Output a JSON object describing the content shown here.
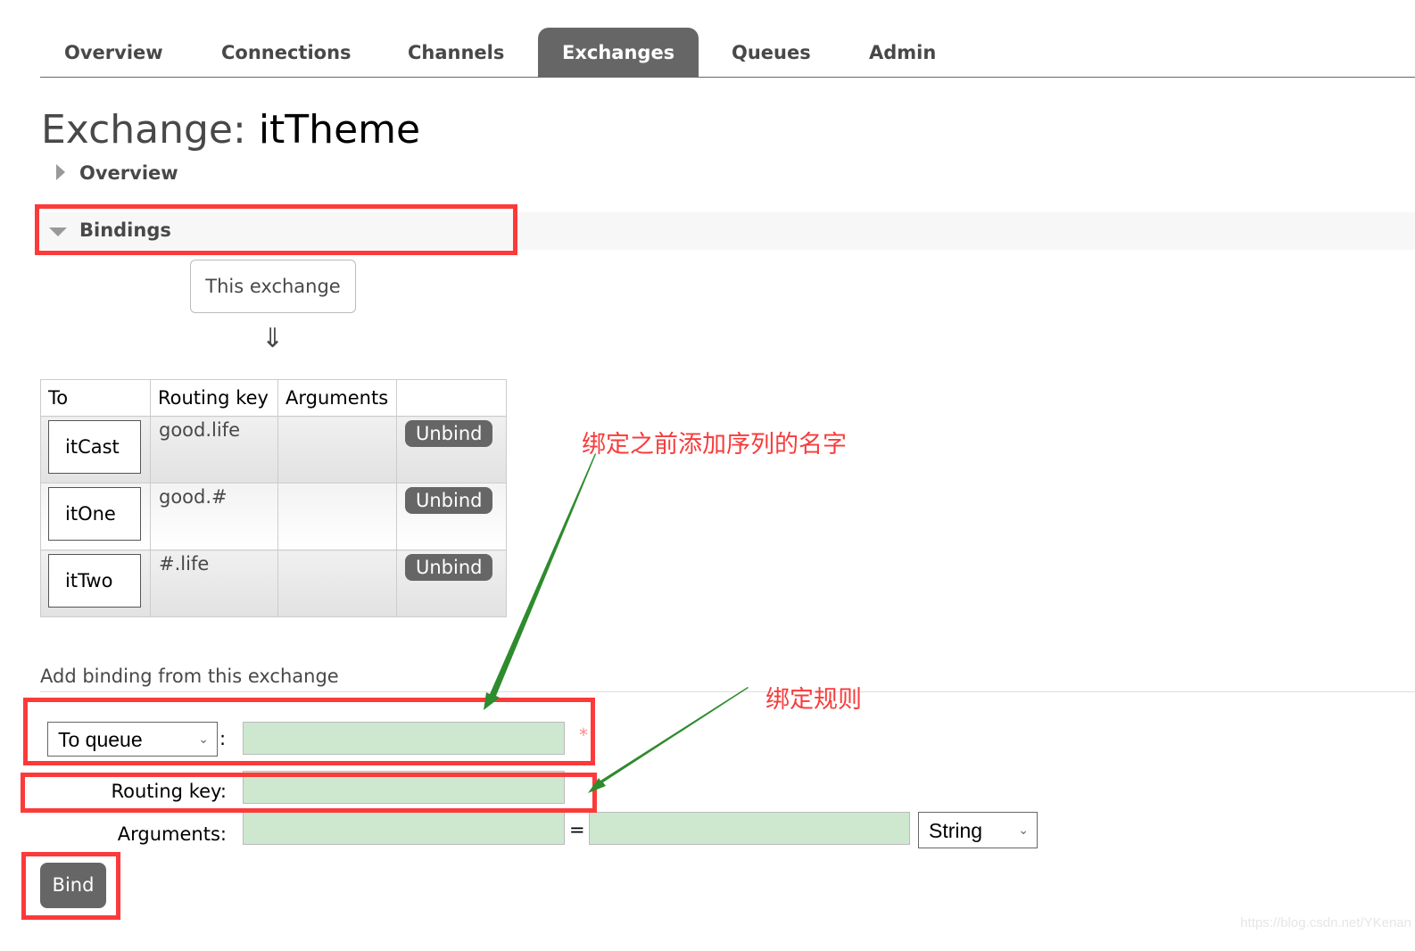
{
  "nav": {
    "tabs": [
      {
        "label": "Overview",
        "active": false
      },
      {
        "label": "Connections",
        "active": false
      },
      {
        "label": "Channels",
        "active": false
      },
      {
        "label": "Exchanges",
        "active": true
      },
      {
        "label": "Queues",
        "active": false
      },
      {
        "label": "Admin",
        "active": false
      }
    ]
  },
  "page": {
    "title_prefix": "Exchange:",
    "title_name": "itTheme"
  },
  "sections": {
    "overview": "Overview",
    "bindings": "Bindings"
  },
  "bindings": {
    "source_label": "This exchange",
    "flow_arrow": "⇓",
    "columns": [
      "To",
      "Routing key",
      "Arguments",
      ""
    ],
    "rows": [
      {
        "to": "itCast",
        "routing_key": "good.life",
        "arguments": "",
        "action": "Unbind"
      },
      {
        "to": "itOne",
        "routing_key": "good.#",
        "arguments": "",
        "action": "Unbind"
      },
      {
        "to": "itTwo",
        "routing_key": "#.life",
        "arguments": "",
        "action": "Unbind"
      }
    ]
  },
  "add_binding": {
    "title": "Add binding from this exchange",
    "destination_type": "To queue",
    "colon": ":",
    "destination_value": "",
    "required_mark": "*",
    "routing_key_label": "Routing key:",
    "routing_key_value": "",
    "arguments_label": "Arguments:",
    "argument_key": "",
    "equals": "=",
    "argument_value": "",
    "argument_type": "String",
    "bind_label": "Bind"
  },
  "annotations": {
    "queue_name_note": "绑定之前添加序列的名字",
    "routing_rule_note": "绑定规则",
    "annotation_color": "#fc3a3a",
    "arrow_color": "#2e8b2e"
  },
  "watermark": "https://blog.csdn.net/YKenan"
}
